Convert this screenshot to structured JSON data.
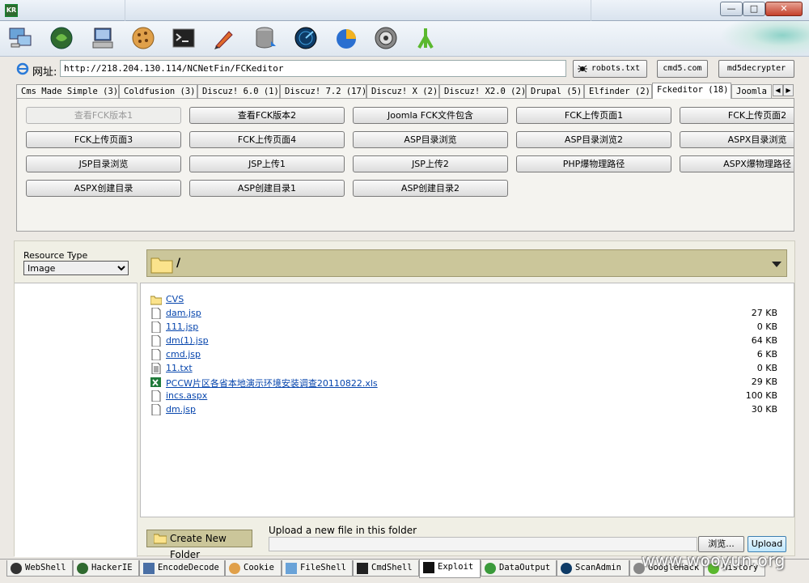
{
  "titlebar": {
    "app_icon": "KR",
    "controls": [
      "minimize-icon",
      "maximize-icon",
      "close-icon"
    ]
  },
  "toolbar": {
    "icons": [
      "network-icon",
      "hacker-ie-icon",
      "computer-icon",
      "cookie-icon",
      "cmd-shell-icon",
      "pen-icon",
      "database-icon",
      "radar-icon",
      "pie-chart-icon",
      "scope-icon",
      "antenna-icon"
    ]
  },
  "address": {
    "label": "网址:",
    "value": "http://218.204.130.114/NCNetFin/FCKeditor",
    "robots_btn": "robots.txt",
    "cmd5_btn": "cmd5.com",
    "md5_btn": "md5decrypter"
  },
  "exploit_tabs": [
    "Cms Made Simple (3)",
    "Coldfusion (3)",
    "Discuz! 6.0 (1)",
    "Discuz! 7.2 (17)",
    "Discuz! X (2)",
    "Discuz! X2.0 (2)",
    "Drupal (5)",
    "Elfinder (2)",
    "Fckeditor (18)",
    "Joomla"
  ],
  "exploit_buttons": [
    {
      "label": "查看FCK版本1",
      "enabled": false
    },
    {
      "label": "查看FCK版本2",
      "enabled": true
    },
    {
      "label": "Joomla FCK文件包含",
      "enabled": true
    },
    {
      "label": "FCK上传页面1",
      "enabled": true
    },
    {
      "label": "FCK上传页面2",
      "enabled": true
    },
    {
      "label": "FCK上传页面3",
      "enabled": true
    },
    {
      "label": "FCK上传页面4",
      "enabled": true
    },
    {
      "label": "ASP目录浏览",
      "enabled": true
    },
    {
      "label": "ASP目录浏览2",
      "enabled": true
    },
    {
      "label": "ASPX目录浏览",
      "enabled": true
    },
    {
      "label": "JSP目录浏览",
      "enabled": true
    },
    {
      "label": "JSP上传1",
      "enabled": true
    },
    {
      "label": "JSP上传2",
      "enabled": true
    },
    {
      "label": "PHP爆物理路径",
      "enabled": true
    },
    {
      "label": "ASPX爆物理路径",
      "enabled": true
    },
    {
      "label": "ASPX创建目录",
      "enabled": true
    },
    {
      "label": "ASP创建目录1",
      "enabled": true
    },
    {
      "label": "ASP创建目录2",
      "enabled": true
    }
  ],
  "browser": {
    "resource_type_label": "Resource Type",
    "resource_type_value": "Image",
    "current_path": "/",
    "files": [
      {
        "name": "CVS",
        "size": "",
        "type": "folder"
      },
      {
        "name": "dam.jsp",
        "size": "27 KB",
        "type": "file"
      },
      {
        "name": "111.jsp",
        "size": "0 KB",
        "type": "file"
      },
      {
        "name": "dm(1).jsp",
        "size": "64 KB",
        "type": "file"
      },
      {
        "name": "cmd.jsp",
        "size": "6 KB",
        "type": "file"
      },
      {
        "name": "11.txt",
        "size": "0 KB",
        "type": "text"
      },
      {
        "name": "PCCW片区各省本地演示环境安装调查20110822.xls",
        "size": "29 KB",
        "type": "excel"
      },
      {
        "name": "incs.aspx",
        "size": "100 KB",
        "type": "file"
      },
      {
        "name": "dm.jsp",
        "size": "30 KB",
        "type": "file"
      }
    ],
    "create_folder": "Create New Folder",
    "upload_label": "Upload a new file in this folder",
    "browse_btn": "浏览...",
    "upload_btn": "Upload"
  },
  "bottom_tabs": [
    "WebShell",
    "HackerIE",
    "EncodeDecode",
    "Cookie",
    "FileShell",
    "CmdShell",
    "Exploit",
    "DataOutput",
    "ScanAdmin",
    "GoogleHack",
    "History"
  ],
  "watermark": "www.wooyun.org",
  "colors": {
    "accent": "#cbc69a",
    "link": "#0645ad",
    "panel": "#f0efe5"
  }
}
